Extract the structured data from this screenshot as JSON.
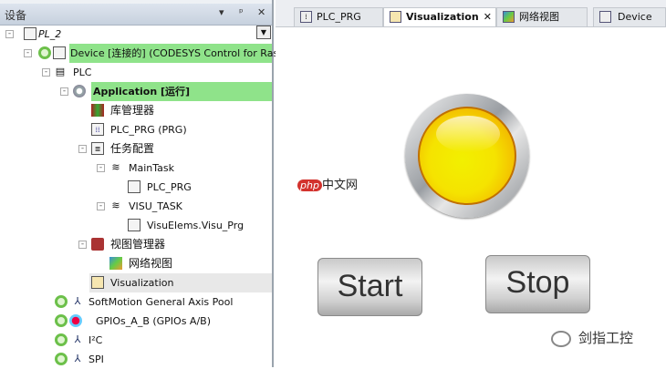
{
  "panel": {
    "title": "设备",
    "pin": "ᵖ",
    "close": "✕",
    "menu": "▾"
  },
  "tree": [
    {
      "label": "PL_2"
    },
    {
      "label": "Device [连接的] (CODESYS Control for Raspb"
    },
    {
      "label": "PLC"
    },
    {
      "label": "Application [运行]"
    },
    {
      "label": "库管理器"
    },
    {
      "label": "PLC_PRG (PRG)"
    },
    {
      "label": "任务配置"
    },
    {
      "label": "MainTask"
    },
    {
      "label": "PLC_PRG"
    },
    {
      "label": "VISU_TASK"
    },
    {
      "label": "VisuElems.Visu_Prg"
    },
    {
      "label": "视图管理器"
    },
    {
      "label": "网络视图"
    },
    {
      "label": "Visualization"
    },
    {
      "label": "SoftMotion General Axis Pool"
    },
    {
      "label": "GPIOs_A_B (GPIOs A/B)"
    },
    {
      "label": "I²C"
    },
    {
      "label": "SPI"
    }
  ],
  "tabs": [
    {
      "label": "PLC_PRG"
    },
    {
      "label": "Visualization",
      "close": "✕"
    },
    {
      "label": "网络视图"
    },
    {
      "label": "Device"
    }
  ],
  "visu": {
    "start": "Start",
    "stop": "Stop",
    "lamp_state": "on",
    "lamp_color": "#f5e300"
  },
  "watermarks": {
    "php": "php",
    "php_text": "中文网",
    "wechat": "剑指工控"
  }
}
